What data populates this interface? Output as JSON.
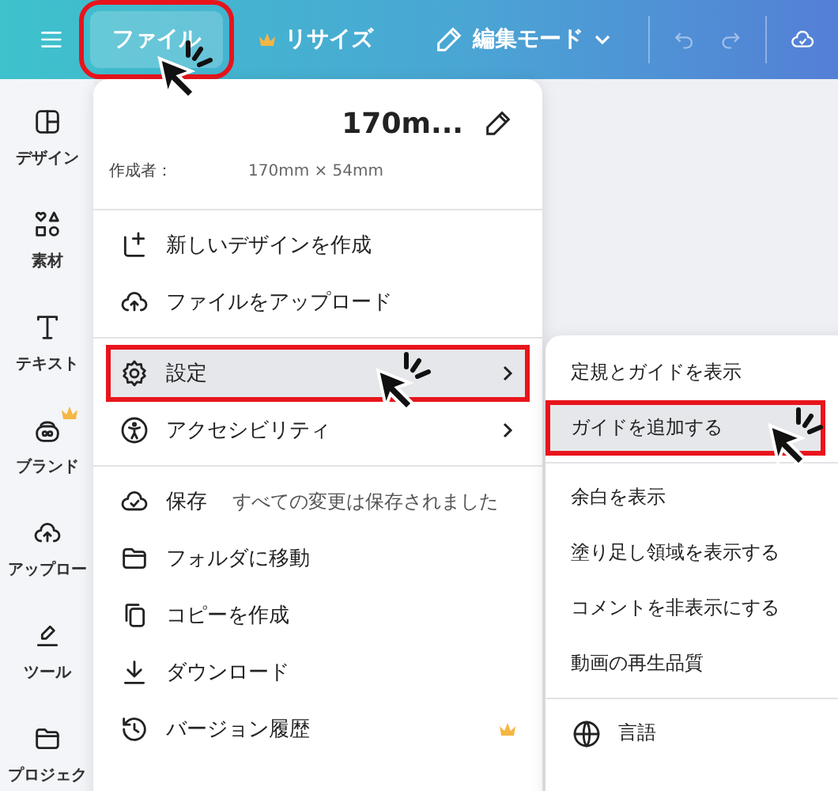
{
  "toolbar": {
    "file_button": {
      "label": "ファイル",
      "highlighted": true
    },
    "resize_button": {
      "label": "リサイズ",
      "premium": true
    },
    "edit_mode": {
      "label": "編集モード"
    }
  },
  "sidebar": {
    "items": [
      {
        "label": "デザイン"
      },
      {
        "label": "素材"
      },
      {
        "label": "テキスト"
      },
      {
        "label": "ブランド",
        "premium": true
      },
      {
        "label": "アップロー"
      },
      {
        "label": "ツール"
      },
      {
        "label": "プロジェク"
      }
    ]
  },
  "file_menu": {
    "title": "170m...",
    "author_label": "作成者：",
    "size": "170mm × 54mm",
    "items": [
      {
        "label": "新しいデザインを作成",
        "divider_before": true,
        "selected": false,
        "highlighted": false
      },
      {
        "label": "ファイルをアップロード",
        "selected": false,
        "highlighted": false
      },
      {
        "label": "設定",
        "divider_before": true,
        "submenu": true,
        "selected": true,
        "highlighted": true
      },
      {
        "label": "アクセシビリティ",
        "submenu": true,
        "selected": false,
        "highlighted": false
      },
      {
        "label": "保存",
        "note": "すべての変更は保存されました",
        "divider_before": true,
        "selected": false,
        "highlighted": false
      },
      {
        "label": "フォルダに移動",
        "selected": false,
        "highlighted": false
      },
      {
        "label": "コピーを作成",
        "selected": false,
        "highlighted": false
      },
      {
        "label": "ダウンロード",
        "selected": false,
        "highlighted": false
      },
      {
        "label": "バージョン履歴",
        "premium": true,
        "selected": false,
        "highlighted": false
      }
    ]
  },
  "settings_submenu": {
    "items": [
      {
        "label": "定規とガイドを表示",
        "selected": false,
        "highlighted": false
      },
      {
        "label": "ガイドを追加する",
        "selected": true,
        "highlighted": true
      },
      {
        "label": "余白を表示",
        "divider_before": true,
        "selected": false,
        "highlighted": false
      },
      {
        "label": "塗り足し領域を表示する",
        "selected": false,
        "highlighted": false
      },
      {
        "label": "コメントを非表示にする",
        "selected": false,
        "highlighted": false
      },
      {
        "label": "動画の再生品質",
        "selected": false,
        "highlighted": false
      },
      {
        "label": "言語",
        "divider_before": true,
        "selected": false,
        "highlighted": false
      }
    ]
  }
}
